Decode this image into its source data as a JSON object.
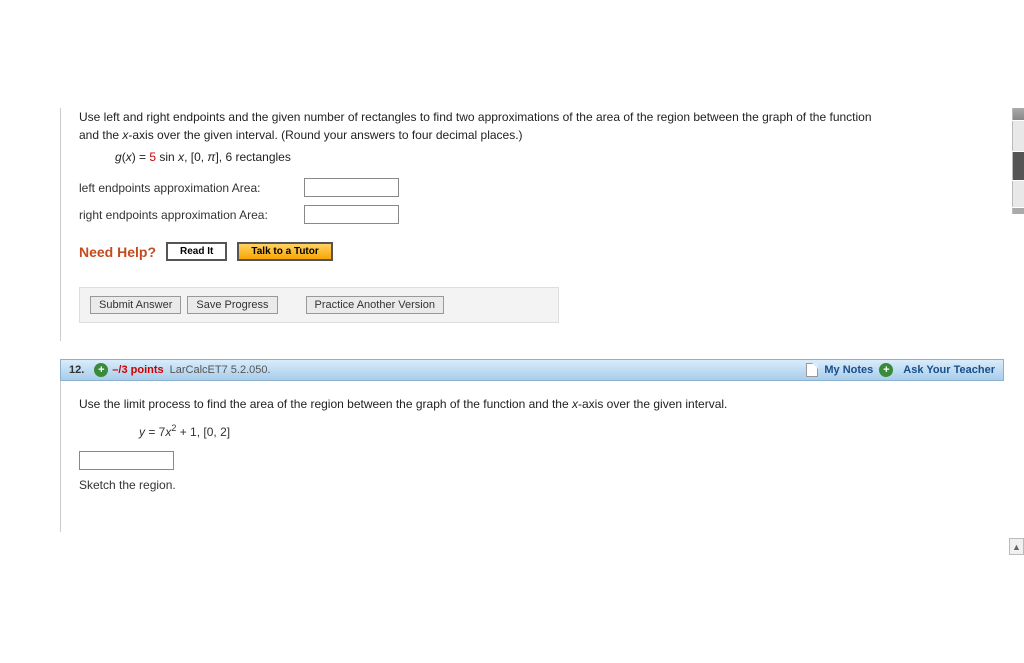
{
  "q11": {
    "prompt_line1": "Use left and right endpoints and the given number of rectangles to find two approximations of the area of the region between the graph of the function",
    "prompt_line2_a": "and the ",
    "prompt_line2_axis": "x",
    "prompt_line2_b": "-axis over the given interval. (Round your answers to four decimal places.)",
    "eqn_pre": "g",
    "eqn_paren": "(",
    "eqn_var": "x",
    "eqn_close": ") = ",
    "eqn_red": "5",
    "eqn_rest_a": " sin ",
    "eqn_rest_x": "x",
    "eqn_rest_b": ", [0, ",
    "eqn_pi": "π",
    "eqn_rest_c": "], 6 rectangles",
    "left_label": "left endpoints approximation Area:",
    "right_label": "right endpoints approximation Area:",
    "need_help": "Need Help?",
    "read_it": "Read It",
    "talk_tutor": "Talk to a Tutor",
    "submit": "Submit Answer",
    "save": "Save Progress",
    "practice": "Practice Another Version"
  },
  "q12header": {
    "number": "12.",
    "score": "–/3 points",
    "ref": "LarCalcET7 5.2.050.",
    "my_notes": "My Notes",
    "ask": "Ask Your Teacher"
  },
  "q12": {
    "prompt_a": "Use the limit process to find the area of the region between the graph of the function and the ",
    "prompt_axis": "x",
    "prompt_b": "-axis over the given interval.",
    "eqn_y": "y",
    "eqn_eq": " = 7",
    "eqn_x": "x",
    "eqn_sup": "2",
    "eqn_tail": " + 1,    [0, 2]",
    "sketch": "Sketch the region."
  }
}
